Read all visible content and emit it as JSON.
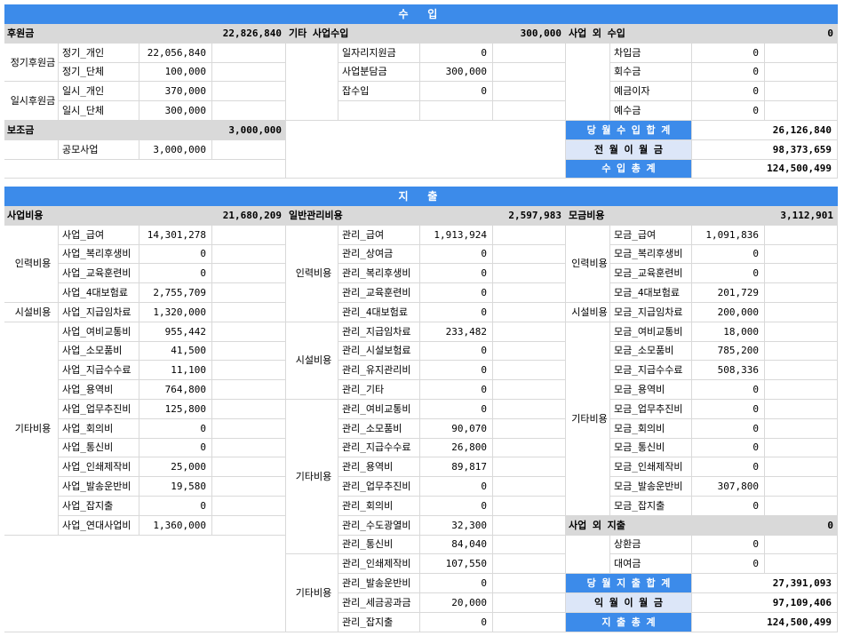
{
  "income": {
    "title": "수 입",
    "donation": {
      "label": "후원금",
      "total": "22,826,840",
      "groups": [
        {
          "label": "정기후원금",
          "items": [
            {
              "label": "정기_개인",
              "value": "22,056,840"
            },
            {
              "label": "정기_단체",
              "value": "100,000"
            }
          ]
        },
        {
          "label": "일시후원금",
          "items": [
            {
              "label": "일시_개인",
              "value": "370,000"
            },
            {
              "label": "일시_단체",
              "value": "300,000"
            }
          ]
        }
      ]
    },
    "subsidy": {
      "label": "보조금",
      "total": "3,000,000",
      "items": [
        {
          "label": "공모사업",
          "value": "3,000,000"
        }
      ]
    },
    "other": {
      "label": "기타 사업수입",
      "total": "300,000",
      "items": [
        {
          "label": "일자리지원금",
          "value": "0"
        },
        {
          "label": "사업분담금",
          "value": "300,000"
        },
        {
          "label": "잡수입",
          "value": "0"
        }
      ]
    },
    "non_business": {
      "label": "사업 외 수입",
      "total": "0",
      "items": [
        {
          "label": "차입금",
          "value": "0"
        },
        {
          "label": "회수금",
          "value": "0"
        },
        {
          "label": "예금이자",
          "value": "0"
        },
        {
          "label": "예수금",
          "value": "0"
        }
      ]
    },
    "summary": [
      {
        "label": "당 월 수 입 합 계",
        "value": "26,126,840"
      },
      {
        "label": "전 월 이 월 금",
        "value": "98,373,659"
      },
      {
        "label": "수 입 총 계",
        "value": "124,500,499"
      }
    ]
  },
  "expense": {
    "title": "지 출",
    "business": {
      "label": "사업비용",
      "total": "21,680,209",
      "groups": [
        {
          "label": "인력비용",
          "items": [
            {
              "label": "사업_급여",
              "value": "14,301,278"
            },
            {
              "label": "사업_복리후생비",
              "value": "0"
            },
            {
              "label": "사업_교육훈련비",
              "value": "0"
            },
            {
              "label": "사업_4대보험료",
              "value": "2,755,709"
            }
          ]
        },
        {
          "label": "시설비용",
          "items": [
            {
              "label": "사업_지급임차료",
              "value": "1,320,000"
            }
          ]
        },
        {
          "label": "기타비용",
          "items": [
            {
              "label": "사업_여비교통비",
              "value": "955,442"
            },
            {
              "label": "사업_소모품비",
              "value": "41,500"
            },
            {
              "label": "사업_지급수수료",
              "value": "11,100"
            },
            {
              "label": "사업_용역비",
              "value": "764,800"
            },
            {
              "label": "사업_업무추진비",
              "value": "125,800"
            },
            {
              "label": "사업_회의비",
              "value": "0"
            },
            {
              "label": "사업_통신비",
              "value": "0"
            },
            {
              "label": "사업_인쇄제작비",
              "value": "25,000"
            },
            {
              "label": "사업_발송운반비",
              "value": "19,580"
            },
            {
              "label": "사업_잡지출",
              "value": "0"
            },
            {
              "label": "사업_연대사업비",
              "value": "1,360,000"
            }
          ]
        }
      ]
    },
    "admin": {
      "label": "일반관리비용",
      "total": "2,597,983",
      "groups": [
        {
          "label": "인력비용",
          "items": [
            {
              "label": "관리_급여",
              "value": "1,913,924"
            },
            {
              "label": "관리_상여금",
              "value": "0"
            },
            {
              "label": "관리_복리후생비",
              "value": "0"
            },
            {
              "label": "관리_교육훈련비",
              "value": "0"
            },
            {
              "label": "관리_4대보험료",
              "value": "0"
            }
          ]
        },
        {
          "label": "시설비용",
          "items": [
            {
              "label": "관리_지급임차료",
              "value": "233,482"
            },
            {
              "label": "관리_시설보험료",
              "value": "0"
            },
            {
              "label": "관리_유지관리비",
              "value": "0"
            },
            {
              "label": "관리_기타",
              "value": "0"
            }
          ]
        },
        {
          "label": "기타비용",
          "items": [
            {
              "label": "관리_여비교통비",
              "value": "0"
            },
            {
              "label": "관리_소모품비",
              "value": "90,070"
            },
            {
              "label": "관리_지급수수료",
              "value": "26,800"
            },
            {
              "label": "관리_용역비",
              "value": "89,817"
            },
            {
              "label": "관리_업무추진비",
              "value": "0"
            },
            {
              "label": "관리_회의비",
              "value": "0"
            },
            {
              "label": "관리_수도광열비",
              "value": "32,300"
            },
            {
              "label": "관리_통신비",
              "value": "84,040"
            }
          ]
        },
        {
          "label": "기타비용",
          "items": [
            {
              "label": "관리_인쇄제작비",
              "value": "107,550"
            },
            {
              "label": "관리_발송운반비",
              "value": "0"
            },
            {
              "label": "관리_세금공과금",
              "value": "20,000"
            },
            {
              "label": "관리_잡지출",
              "value": "0"
            }
          ]
        }
      ]
    },
    "fundraising": {
      "label": "모금비용",
      "total": "3,112,901",
      "groups": [
        {
          "label": "인력비용",
          "items": [
            {
              "label": "모금_급여",
              "value": "1,091,836"
            },
            {
              "label": "모금_복리후생비",
              "value": "0"
            },
            {
              "label": "모금_교육훈련비",
              "value": "0"
            },
            {
              "label": "모금_4대보험료",
              "value": "201,729"
            }
          ]
        },
        {
          "label": "시설비용",
          "items": [
            {
              "label": "모금_지급임차료",
              "value": "200,000"
            }
          ]
        },
        {
          "label": "기타비용",
          "items": [
            {
              "label": "모금_여비교통비",
              "value": "18,000"
            },
            {
              "label": "모금_소모품비",
              "value": "785,200"
            },
            {
              "label": "모금_지급수수료",
              "value": "508,336"
            },
            {
              "label": "모금_용역비",
              "value": "0"
            },
            {
              "label": "모금_업무추진비",
              "value": "0"
            },
            {
              "label": "모금_회의비",
              "value": "0"
            },
            {
              "label": "모금_통신비",
              "value": "0"
            },
            {
              "label": "모금_인쇄제작비",
              "value": "0"
            },
            {
              "label": "모금_발송운반비",
              "value": "307,800"
            },
            {
              "label": "모금_잡지출",
              "value": "0"
            }
          ]
        }
      ]
    },
    "non_business": {
      "label": "사업 외 지출",
      "total": "0",
      "items": [
        {
          "label": "상환금",
          "value": "0"
        },
        {
          "label": "대여금",
          "value": "0"
        }
      ]
    },
    "summary": [
      {
        "label": "당 월 지 출 합 계",
        "value": "27,391,093"
      },
      {
        "label": "익 월 이 월 금",
        "value": "97,109,406"
      },
      {
        "label": "지 출 총 계",
        "value": "124,500,499"
      }
    ]
  }
}
